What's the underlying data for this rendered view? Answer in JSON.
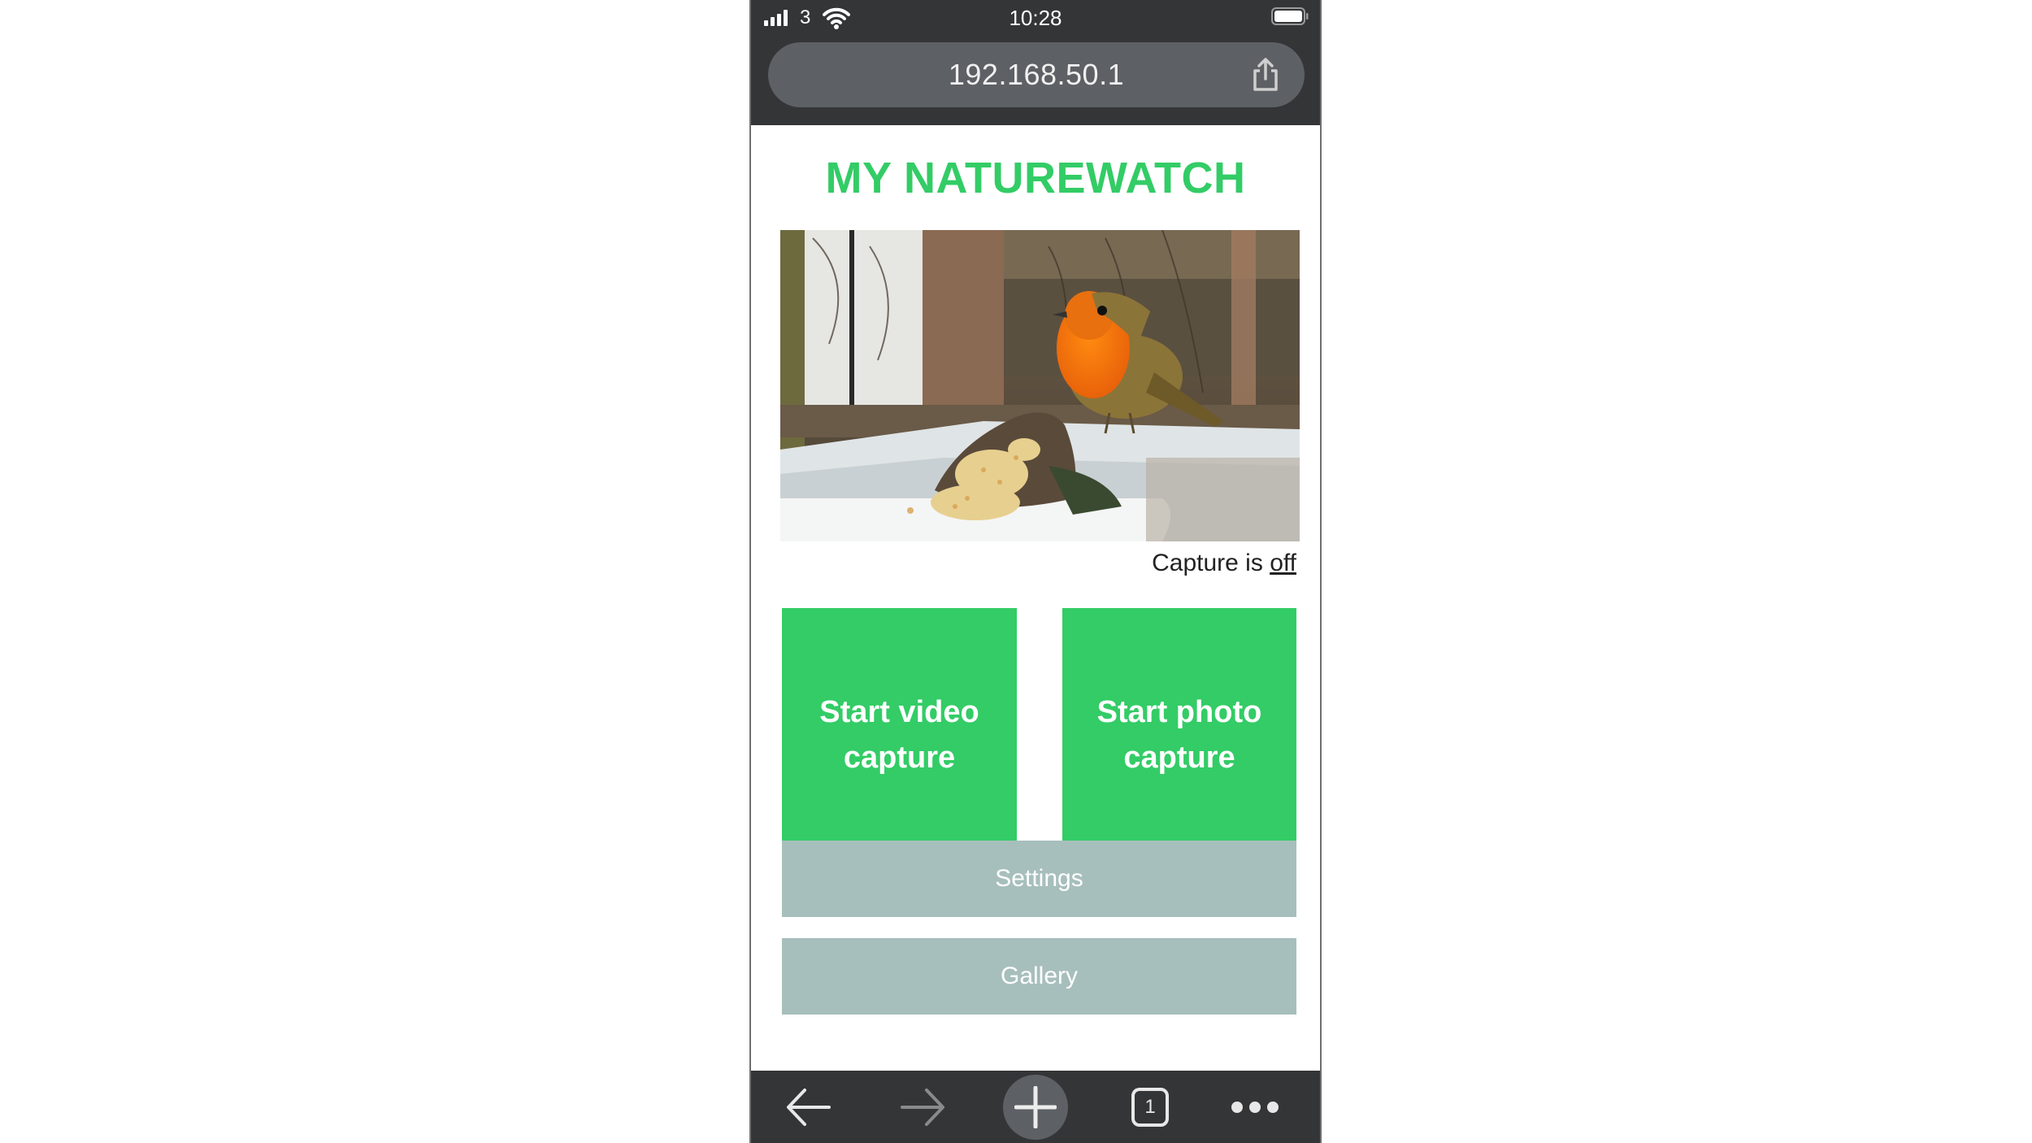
{
  "status_bar": {
    "carrier": "3",
    "time": "10:28",
    "icons": [
      "signal-bars-icon",
      "wifi-icon",
      "battery-icon"
    ]
  },
  "browser": {
    "url": "192.168.50.1",
    "share_icon": "share-icon",
    "toolbar": {
      "back_icon": "back-arrow-icon",
      "forward_icon": "forward-arrow-icon",
      "new_tab_icon": "plus-icon",
      "tab_count": "1",
      "more_icon": "more-dots-icon"
    }
  },
  "page": {
    "title": "MY NATUREWATCH",
    "camera_feed": {
      "description": "Live camera view: robin perched on a log by a bird feeder tray with seeds"
    },
    "capture_status": {
      "prefix": "Capture is ",
      "state": "off"
    },
    "buttons": {
      "video": "Start video capture",
      "photo": "Start photo capture",
      "settings": "Settings",
      "gallery": "Gallery"
    },
    "colors": {
      "accent_green": "#33cc66",
      "secondary_grey": "#a7bfbc",
      "chrome_dark": "#343537"
    }
  }
}
